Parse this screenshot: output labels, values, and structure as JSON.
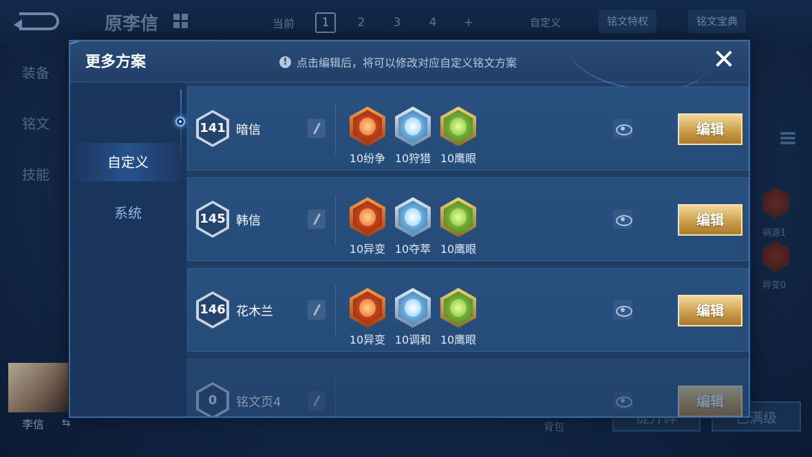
{
  "background": {
    "hero_title": "原李信",
    "current_label": "当前",
    "page_tabs": [
      "1",
      "2",
      "3",
      "4",
      "+"
    ],
    "custom_label": "自定义",
    "rune_privilege": "铭文特权",
    "rune_dictionary": "铭文宝典",
    "side_nav": [
      "装备",
      "铭文",
      "技能"
    ],
    "right_runes": [
      "祸源1",
      "异变0"
    ],
    "hero_name": "李信",
    "bag_label": "背包",
    "bottom_buttons": [
      "提升碎",
      "已满级"
    ]
  },
  "modal": {
    "title": "更多方案",
    "notice": "点击编辑后，将可以修改对应自定义铭文方案",
    "notice_icon": "!",
    "close_label": "✕",
    "tabs": [
      {
        "label": "自定义",
        "active": true
      },
      {
        "label": "系统",
        "active": false
      }
    ],
    "edit_label": "编辑",
    "plans": [
      {
        "level": "141",
        "name": "暗信",
        "runes": [
          {
            "label": "10纷争",
            "color": "red",
            "icon": "discord-rune-icon"
          },
          {
            "label": "10狩猎",
            "color": "blue",
            "icon": "hunt-rune-icon"
          },
          {
            "label": "10鹰眼",
            "color": "green",
            "icon": "hawkeye-rune-icon"
          }
        ]
      },
      {
        "level": "145",
        "name": "韩信",
        "runes": [
          {
            "label": "10异变",
            "color": "red",
            "icon": "mutation-rune-icon"
          },
          {
            "label": "10夺萃",
            "color": "blue",
            "icon": "plunder-rune-icon"
          },
          {
            "label": "10鹰眼",
            "color": "green",
            "icon": "hawkeye-rune-icon"
          }
        ]
      },
      {
        "level": "146",
        "name": "花木兰",
        "runes": [
          {
            "label": "10异变",
            "color": "red",
            "icon": "mutation-rune-icon"
          },
          {
            "label": "10调和",
            "color": "blue",
            "icon": "harmony-rune-icon"
          },
          {
            "label": "10鹰眼",
            "color": "green",
            "icon": "hawkeye-rune-icon"
          }
        ]
      },
      {
        "level": "0",
        "name": "铭文页4",
        "runes": []
      }
    ]
  }
}
